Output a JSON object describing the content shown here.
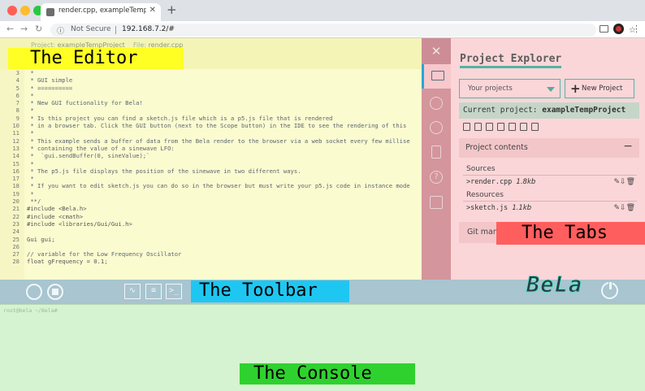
{
  "browser": {
    "tab_title": "render.cpp, exampleTempProject",
    "security": "Not Secure",
    "url": "192.168.7.2/#"
  },
  "editor": {
    "breadcrumb_project_key": "Project:",
    "breadcrumb_project": "exampleTempProject",
    "breadcrumb_file_key": "File:",
    "breadcrumb_file": "render.cpp",
    "lines": [
      {
        "n": "3",
        "t": " *",
        "c": true
      },
      {
        "n": "4",
        "t": " * GUI simple",
        "c": true
      },
      {
        "n": "5",
        "t": " * ==========",
        "c": true
      },
      {
        "n": "6",
        "t": " *",
        "c": true
      },
      {
        "n": "7",
        "t": " * New GUI fuctionality for Bela!",
        "c": true
      },
      {
        "n": "8",
        "t": " *",
        "c": true
      },
      {
        "n": "9",
        "t": " * Is this project you can find a sketch.js file which is a p5.js file that is rendered",
        "c": true
      },
      {
        "n": "10",
        "t": " * in a browser tab. Click the GUI button (next to the Scope button) in the IDE to see the rendering of this",
        "c": true
      },
      {
        "n": "11",
        "t": " *",
        "c": true
      },
      {
        "n": "12",
        "t": " * This example sends a buffer of data from the Bela render to the browser via a web socket every few millise",
        "c": true
      },
      {
        "n": "13",
        "t": " * containing the value of a sinewave LFO:",
        "c": true
      },
      {
        "n": "14",
        "t": " *  `gui.sendBuffer(0, sineValue);`",
        "c": true
      },
      {
        "n": "15",
        "t": " *",
        "c": true
      },
      {
        "n": "16",
        "t": " * The p5.js file displays the position of the sinewave in two different ways.",
        "c": true
      },
      {
        "n": "17",
        "t": " *",
        "c": true
      },
      {
        "n": "18",
        "t": " * If you want to edit sketch.js you can do so in the browser but must write your p5.js code in instance mode",
        "c": true
      },
      {
        "n": "19",
        "t": " *",
        "c": true
      },
      {
        "n": "20",
        "t": " **/",
        "c": true
      },
      {
        "n": "21",
        "t": "#include <Bela.h>",
        "c": false
      },
      {
        "n": "22",
        "t": "#include <cmath>",
        "c": false
      },
      {
        "n": "23",
        "t": "#include <libraries/Gui/Gui.h>",
        "c": false
      },
      {
        "n": "24",
        "t": "",
        "c": false
      },
      {
        "n": "25",
        "t": "Gui gui;",
        "c": false
      },
      {
        "n": "26",
        "t": "",
        "c": false
      },
      {
        "n": "27",
        "t": "// variable for the Low Frequency Oscillator",
        "c": true
      },
      {
        "n": "28",
        "t": "float gFrequency = 0.1;",
        "c": false
      }
    ]
  },
  "explorer": {
    "title": "Project Explorer",
    "select_value": "Your projects",
    "new_project_label": "New Project",
    "current_project_label": "Current project:",
    "current_project_name": "exampleTempProject",
    "contents_label": "Project contents",
    "contents_toggle": "−",
    "sources_label": "Sources",
    "resources_label": "Resources",
    "sources": [
      {
        "name": ">render.cpp",
        "size": "1.8kb"
      }
    ],
    "resources": [
      {
        "name": ">sketch.js",
        "size": "1.1kb"
      }
    ],
    "git_label": "Git man"
  },
  "toolbar": {
    "logo": "BeLa"
  },
  "console": {
    "prompt": "root@bela ~/Bela#"
  },
  "labels": {
    "editor": "The Editor",
    "tabs": "The Tabs",
    "toolbar": "The Toolbar",
    "console": "The Console"
  },
  "icons": {
    "close_tab": "close-icon",
    "folder_tab": "folder-icon",
    "examples_tab": "lightbulb-icon",
    "settings_tab": "gear-icon",
    "pin_tab": "chip-icon",
    "help_tab": "question-icon",
    "docs_tab": "book-icon"
  }
}
